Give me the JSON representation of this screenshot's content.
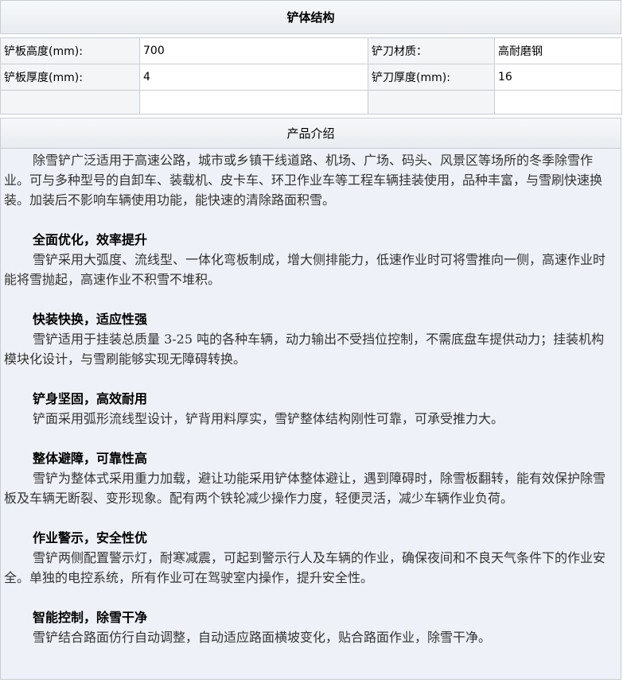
{
  "structure": {
    "title": "铲体结构",
    "rows": [
      {
        "label1": "铲板高度(mm):",
        "value1": "700",
        "label2": "铲刀材质：",
        "value2": "高耐磨钢"
      },
      {
        "label1": "铲板厚度(mm):",
        "value1": "4",
        "label2": "铲刀厚度(mm):",
        "value2": "16"
      }
    ]
  },
  "intro": {
    "title": "产品介绍",
    "lead": "除雪铲广泛适用于高速公路，城市或乡镇干线道路、机场、广场、码头、风景区等场所的冬季除雪作业。可与多种型号的自卸车、装载机、皮卡车、环卫作业车等工程车辆挂装使用，品种丰富，与雪刷快速换装。加装后不影响车辆使用功能，能快速的清除路面积雪。",
    "sections": [
      {
        "heading": "全面优化，效率提升",
        "text": "雪铲采用大弧度、流线型、一体化弯板制成，增大侧排能力，低速作业时可将雪推向一侧，高速作业时能将雪抛起，高速作业不积雪不堆积。"
      },
      {
        "heading": "快装快换，适应性强",
        "text": "雪铲适用于挂装总质量 3-25 吨的各种车辆，动力输出不受挡位控制，不需底盘车提供动力；挂装机构模块化设计，与雪刷能够实现无障碍转换。"
      },
      {
        "heading": "铲身坚固，高效耐用",
        "text": "铲面采用弧形流线型设计，铲背用料厚实，雪铲整体结构刚性可靠，可承受推力大。"
      },
      {
        "heading": "整体避障，可靠性高",
        "text": "雪铲为整体式采用重力加载，避让功能采用铲体整体避让，遇到障碍时，除雪板翻转，能有效保护除雪板及车辆无断裂、变形现象。配有两个铁轮减少操作力度，轻便灵活，减少车辆作业负荷。"
      },
      {
        "heading": "作业警示，安全性优",
        "text": "雪铲两侧配置警示灯，耐寒减震，可起到警示行人及车辆的作业，确保夜间和不良天气条件下的作业安全。单独的电控系统，所有作业可在驾驶室内操作，提升安全性。"
      },
      {
        "heading": "智能控制，除雪干净",
        "text": "雪铲结合路面仿行自动调整，自动适应路面横坡变化，贴合路面作业，除雪干净。"
      }
    ]
  }
}
